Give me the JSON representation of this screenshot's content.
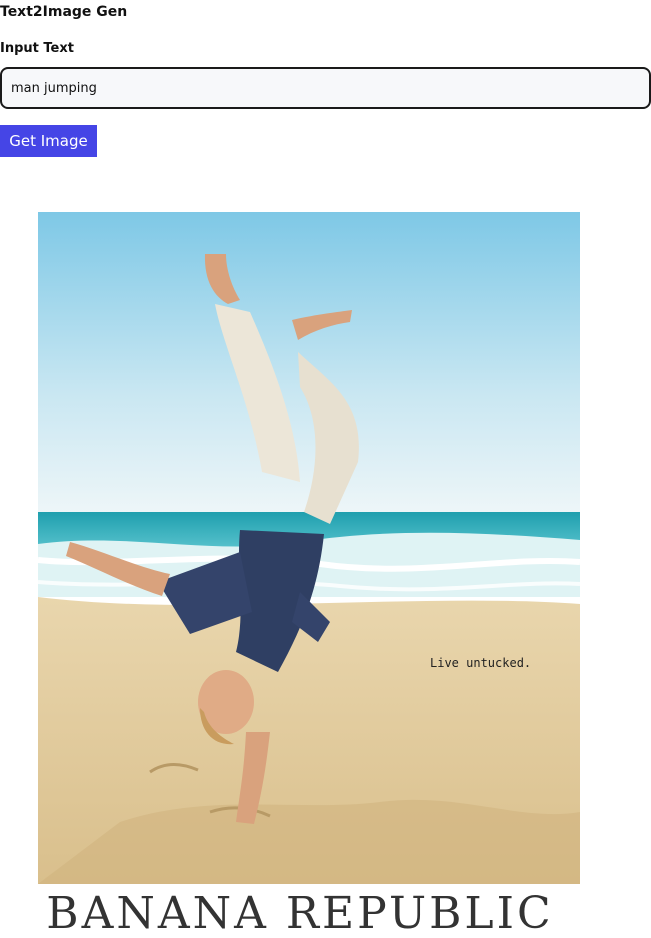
{
  "app": {
    "title": "Text2Image Gen"
  },
  "form": {
    "input_label": "Input Text",
    "input_value": "man jumping",
    "button_label": "Get Image"
  },
  "result": {
    "image_tagline": "Live untucked.",
    "image_brand": "BANANA REPUBLIC"
  },
  "colors": {
    "button_background": "#4545e6",
    "input_border": "#1a1a1a"
  }
}
